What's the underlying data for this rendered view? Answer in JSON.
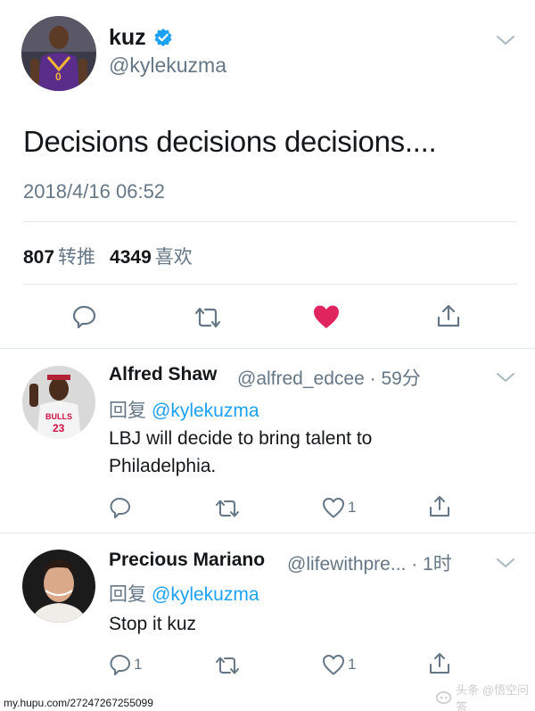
{
  "main_tweet": {
    "display_name": "kuz",
    "handle": "@kylekuzma",
    "text": "Decisions decisions decisions....",
    "timestamp": "2018/4/16 06:52",
    "retweets_count": "807",
    "retweets_label": "转推",
    "likes_count": "4349",
    "likes_label": "喜欢",
    "avatar_icon": "player-avatar",
    "verified_icon": "verified-badge-icon",
    "colors": {
      "verified": "#1da1f2",
      "like": "#e0245e",
      "icon": "#657786"
    }
  },
  "replies": [
    {
      "display_name": "Alfred Shaw",
      "handle": "@alfred_edcee",
      "separator": "·",
      "time": "59分",
      "reply_label": "回复",
      "mention": "@kylekuzma",
      "text_lines": [
        "LBJ will decide to bring talent to",
        "Philadelphia."
      ],
      "reply_count": "",
      "like_count": "1"
    },
    {
      "display_name": "Precious Mariano",
      "handle": "@lifewithpre...",
      "separator": "·",
      "time": "1时",
      "reply_label": "回复",
      "mention": "@kylekuzma",
      "text_lines": [
        "Stop it kuz"
      ],
      "reply_count": "1",
      "like_count": "1"
    }
  ],
  "watermark": {
    "url": "my.hupu.com/27247267255099",
    "logo_text": "头条 @悟空问答"
  }
}
